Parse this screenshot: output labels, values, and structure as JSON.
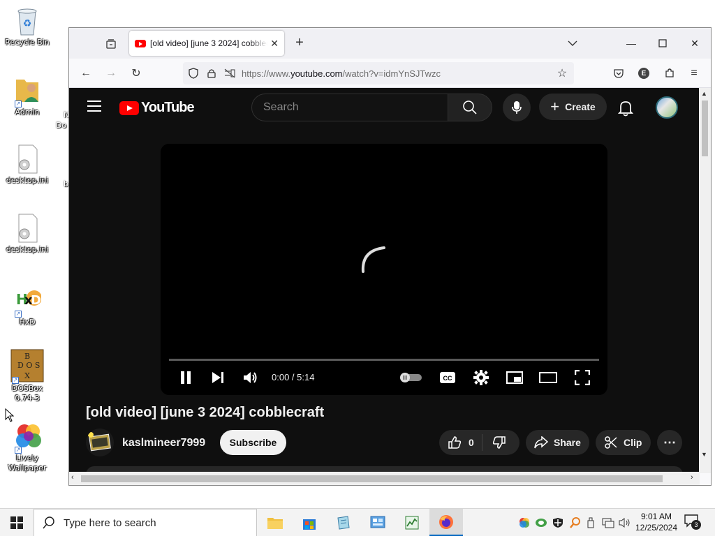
{
  "desktop": {
    "icons": [
      {
        "label": "Recycle Bin"
      },
      {
        "label": "Admin"
      },
      {
        "label": "desktop.ini"
      },
      {
        "label": "desktop.ini"
      },
      {
        "label": "HxD"
      },
      {
        "label": "DOSBox 0.74-3"
      },
      {
        "label": "Lively Wallpaper"
      }
    ],
    "partial_labels": [
      "N",
      "Do",
      "b"
    ]
  },
  "browser": {
    "tab_title": "[old video] [june 3 2024] cobblecraft",
    "url_prefix": "https://www.",
    "url_domain": "youtube.com",
    "url_path": "/watch?v=idmYnSJTwzc"
  },
  "youtube": {
    "logo_text": "YouTube",
    "search_placeholder": "Search",
    "create_label": "Create",
    "player": {
      "time": "0:00 / 5:14",
      "progress": 0.0,
      "state": "loading"
    },
    "video_title": "[old video] [june 3 2024] cobblecraft",
    "channel_name": "kaslmineer7999",
    "subscribe_label": "Subscribe",
    "like_count": "0",
    "share_label": "Share",
    "clip_label": "Clip"
  },
  "taskbar": {
    "search_placeholder": "Type here to search",
    "time": "9:01 AM",
    "date": "12/25/2024",
    "notification_count": "3"
  }
}
